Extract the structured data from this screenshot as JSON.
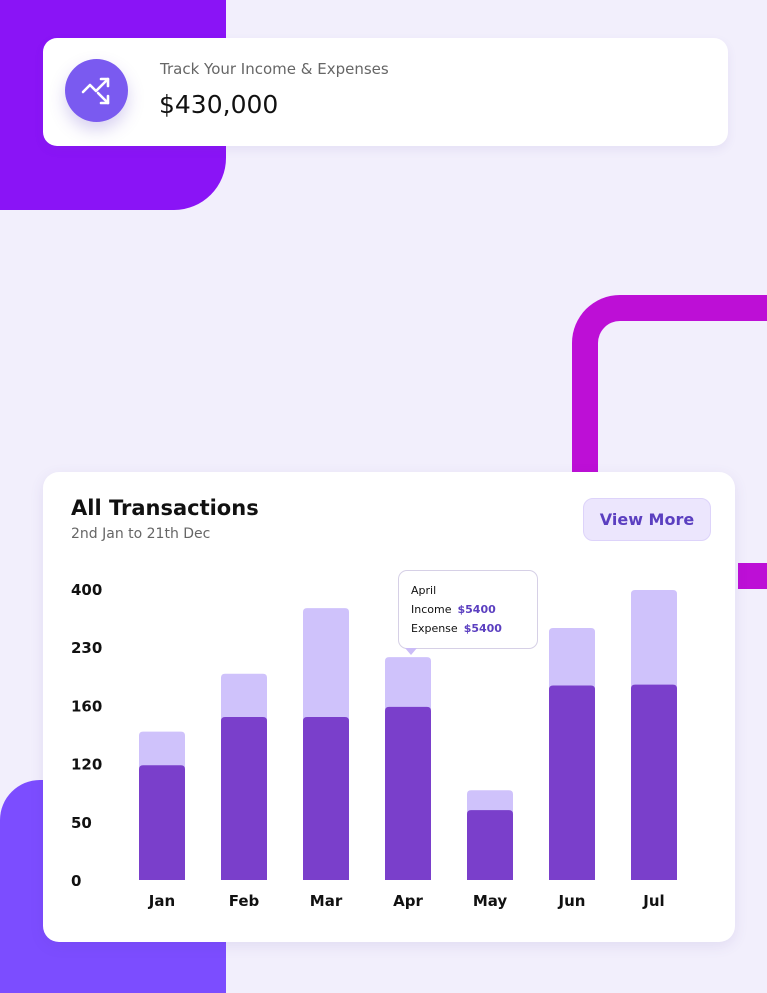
{
  "summary": {
    "subtitle": "Track Your Income & Expenses",
    "amount": "$430,000",
    "icon": "trending-arrows-icon"
  },
  "colors": {
    "accent": "#7a5af0",
    "income": "#cfc2fb",
    "expense": "#7a3fcb"
  },
  "chart_data": {
    "type": "bar",
    "stacked": "overlay",
    "title": "All Transactions",
    "subtitle": "2nd Jan to 21th Dec",
    "categories": [
      "Jan",
      "Feb",
      "Mar",
      "Apr",
      "May",
      "Jun",
      "Jul"
    ],
    "yticks": [
      0,
      50,
      120,
      160,
      230,
      400
    ],
    "ylim": [
      0,
      400
    ],
    "series": [
      {
        "name": "Income",
        "values": [
          142,
          198,
          344,
          218,
          88,
          286,
          397
        ]
      },
      {
        "name": "Expense",
        "values": [
          118,
          152,
          152,
          159,
          64,
          184,
          185
        ]
      }
    ],
    "tooltip": {
      "month": "April",
      "income_label": "Income",
      "income_value": "$5400",
      "expense_label": "Expense",
      "expense_value": "$5400"
    }
  },
  "view_more": "View More"
}
